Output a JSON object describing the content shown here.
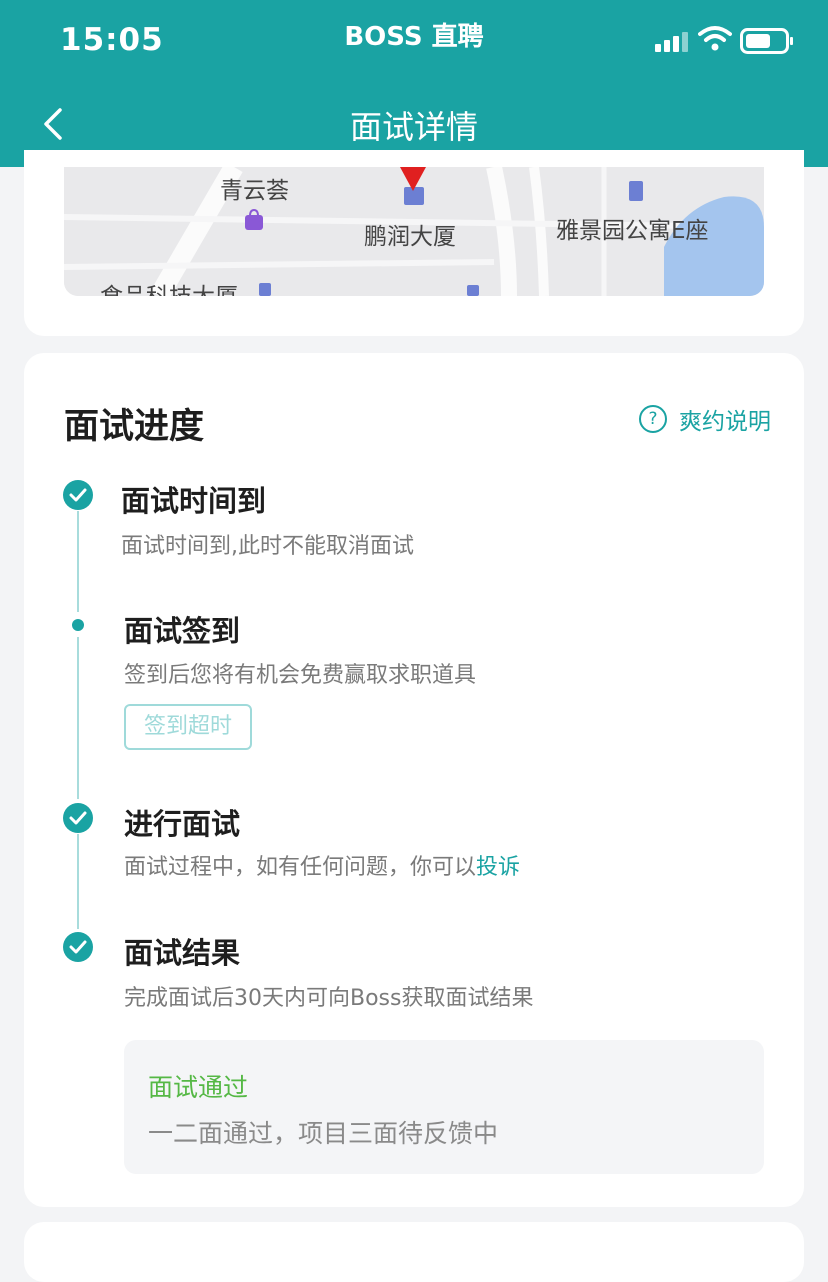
{
  "status_bar": {
    "time": "15:05",
    "carrier": "BOSS 直聘"
  },
  "nav": {
    "title": "面试详情"
  },
  "map": {
    "labels": [
      "青云荟",
      "鹏润大厦",
      "雅景园公寓E座",
      "食品科技大厦"
    ]
  },
  "progress": {
    "title": "面试进度",
    "help_label": "爽约说明",
    "steps": [
      {
        "title": "面试时间到",
        "desc": "面试时间到,此时不能取消面试",
        "status": "done"
      },
      {
        "title": "面试签到",
        "desc": "签到后您将有机会免费赢取求职道具",
        "button": "签到超时",
        "status": "current"
      },
      {
        "title": "进行面试",
        "desc": "面试过程中，如有任何问题，你可以",
        "link": "投诉",
        "status": "done"
      },
      {
        "title": "面试结果",
        "desc": "完成面试后30天内可向Boss获取面试结果",
        "status": "done"
      }
    ],
    "result": {
      "status": "面试通过",
      "note": "一二面通过，项目三面待反馈中"
    }
  },
  "colors": {
    "primary": "#1aa3a3",
    "success": "#55b845"
  },
  "icons": [
    "back-arrow-icon",
    "signal-icon",
    "wifi-icon",
    "battery-icon",
    "map-pin-icon",
    "question-icon",
    "check-icon"
  ]
}
